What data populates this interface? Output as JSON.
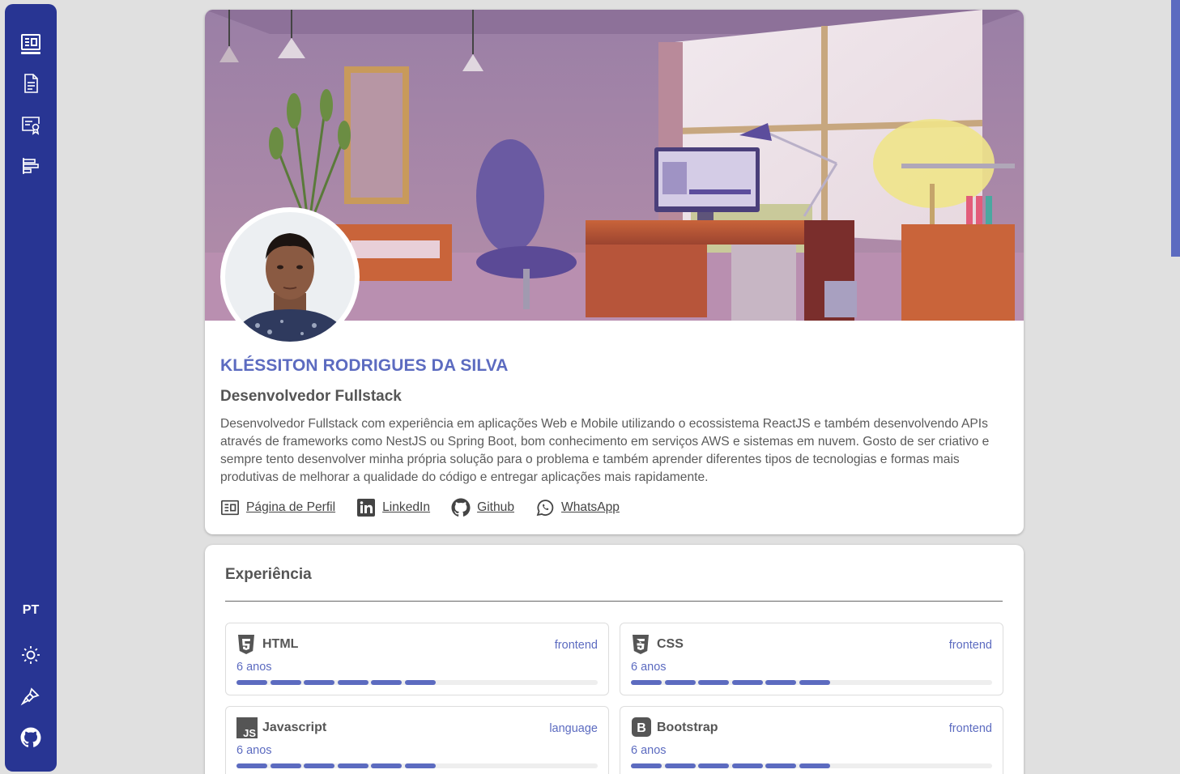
{
  "sidebar": {
    "items": [
      {
        "icon": "profile-card-icon"
      },
      {
        "icon": "document-icon"
      },
      {
        "icon": "certificate-icon"
      },
      {
        "icon": "bar-chart-icon"
      }
    ],
    "language": "PT",
    "bottom_icons": [
      "sun-icon",
      "paint-brush-icon",
      "github-icon"
    ]
  },
  "profile": {
    "name": "KLÉSSITON RODRIGUES DA SILVA",
    "role": "Desenvolvedor Fullstack",
    "bio": "Desenvolvedor Fullstack com experiência em aplicações Web e Mobile utilizando o ecossistema ReactJS e também desenvolvendo APIs através de frameworks como NestJS ou Spring Boot, bom conhecimento em serviços AWS e sistemas em nuvem. Gosto de ser criativo e sempre tento desenvolver minha própria solução para o problema e também aprender diferentes tipos de tecnologias e formas mais produtivas de melhorar a qualidade do código e entregar aplicações mais rapidamente.",
    "links": [
      {
        "label": "Página de Perfil",
        "icon": "profile-card-icon"
      },
      {
        "label": "LinkedIn",
        "icon": "linkedin-icon"
      },
      {
        "label": "Github",
        "icon": "github-icon"
      },
      {
        "label": "WhatsApp",
        "icon": "whatsapp-icon"
      }
    ]
  },
  "experience": {
    "title": "Experiência",
    "skills": [
      {
        "name": "HTML",
        "category": "frontend",
        "years": "6 anos",
        "level": 6,
        "icon": "html5-icon"
      },
      {
        "name": "CSS",
        "category": "frontend",
        "years": "6 anos",
        "level": 6,
        "icon": "css3-icon"
      },
      {
        "name": "Javascript",
        "category": "language",
        "years": "6 anos",
        "level": 6,
        "icon": "javascript-icon"
      },
      {
        "name": "Bootstrap",
        "category": "frontend",
        "years": "6 anos",
        "level": 6,
        "icon": "bootstrap-icon"
      }
    ]
  },
  "colors": {
    "sidebar": "#283593",
    "accent": "#5c6bc0",
    "background": "#e0e0e0"
  }
}
